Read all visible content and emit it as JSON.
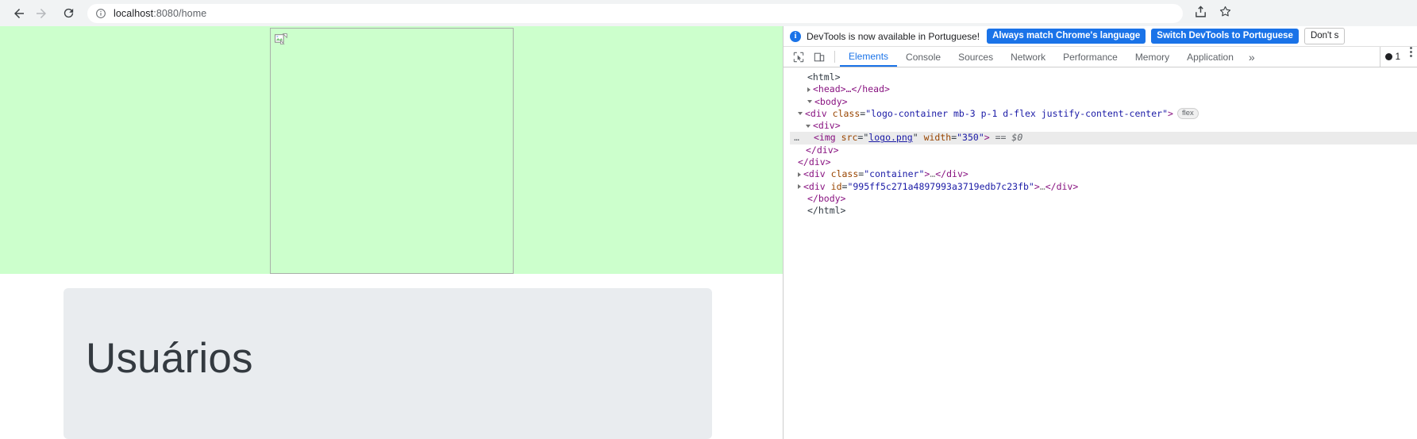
{
  "browser": {
    "back_label": "Back",
    "forward_label": "Forward",
    "reload_label": "Reload",
    "site_info_label": "site-information",
    "url_prefix": "localhost",
    "url_suffix": ":8080/home",
    "url_full": "localhost:8080/home",
    "share_label": "Share",
    "star_label": "Bookmark"
  },
  "page": {
    "logo_alt": "broken-image",
    "card_title": "Usuários"
  },
  "devtools": {
    "infobar": {
      "icon": "i",
      "message": "DevTools is now available in Portuguese!",
      "buttons": [
        {
          "label": "Always match Chrome's language",
          "style": "primary"
        },
        {
          "label": "Switch DevTools to Portuguese",
          "style": "primary"
        },
        {
          "label": "Don't s",
          "style": "plain"
        }
      ]
    },
    "tabs": [
      {
        "label": "Elements",
        "active": true
      },
      {
        "label": "Console",
        "active": false
      },
      {
        "label": "Sources",
        "active": false
      },
      {
        "label": "Network",
        "active": false
      },
      {
        "label": "Performance",
        "active": false
      },
      {
        "label": "Memory",
        "active": false
      },
      {
        "label": "Application",
        "active": false
      }
    ],
    "more_tabs": "»",
    "error_count": "1",
    "inspect_icon": "inspect-element-icon",
    "device_icon": "device-toolbar-icon",
    "dom": {
      "row0": {
        "text": "<html>"
      },
      "row1": {
        "text": "<head>…</head>"
      },
      "row2": {
        "text": "<body>"
      },
      "row3": {
        "tag_open": "<div",
        "attr": "class",
        "value": "\"logo-container mb-3 p-1 d-flex justify-content-center\"",
        "tag_close": ">",
        "badge": "flex"
      },
      "row4": {
        "text": "<div>"
      },
      "row5": {
        "gutter": "…",
        "tag_open": "<img",
        "attr1": "src",
        "value1": "\"logo.png\"",
        "attr2": "width",
        "value2": "\"350\"",
        "tag_close": ">",
        "selected_marker": "== $0"
      },
      "row6": {
        "text": "</div>"
      },
      "row7": {
        "text": "</div>"
      },
      "row8": {
        "tag_open": "<div",
        "attr": "class",
        "value": "\"container\"",
        "tag_close": ">",
        "ellipsis": "…",
        "end": "</div>"
      },
      "row9": {
        "tag_open": "<div",
        "attr": "id",
        "value": "\"995ff5c271a4897993a3719edb7c23fb\"",
        "tag_close": ">",
        "ellipsis": "…",
        "end": "</div>"
      },
      "row10": {
        "text": "</body>"
      },
      "row11": {
        "text": "</html>"
      }
    }
  },
  "colors": {
    "accent": "#1a73e8",
    "page_green": "#ccffcc",
    "card_gray": "#e9ecef",
    "toolbar_gray": "#f1f3f4"
  }
}
